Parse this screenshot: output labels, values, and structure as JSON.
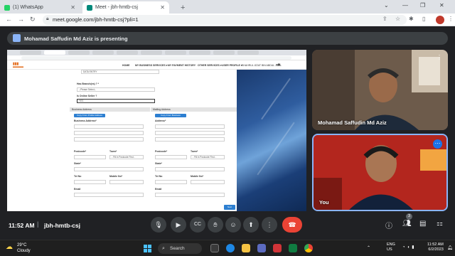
{
  "browser": {
    "tabs": [
      {
        "title": "(1) WhatsApp",
        "color": "#25d366"
      },
      {
        "title": "Meet - jbh-hmtb-csj",
        "color": "#00897b"
      }
    ],
    "new_tab": "+",
    "url": "meet.google.com/jbh-hmtb-csj?pli=1"
  },
  "meet": {
    "presenting_banner": "Mohamad Saffudin Md Aziz is presenting",
    "shared_screen": {
      "site_nav": [
        "HOME",
        "MY BUSINESS SERVICES ▾",
        "MY PAYMENT HISTORY",
        "OTHER SERVICES ▾",
        "USER PROFILE ▾"
      ],
      "user_badge": "SHAHRUL IZZAT BIN ABDUL JALIL",
      "fields": {
        "data_entry": "DATA ENTRY",
        "has_branch_label": "Has Branch(es) ? *",
        "has_branch_value": "--Please Select--",
        "is_online_seller_label": "Is Online Seller ?",
        "is_online_seller_value": "YES",
        "business_address_header": "Business Address",
        "mailing_address_header": "Mailing Address",
        "copy_profile_btn": "Copy From Profile Address",
        "copy_business_btn": "Copy From Business",
        "business_address_label": "Business Address*",
        "address_label": "Address*",
        "postcode_label": "Postcode*",
        "town_label": "Town*",
        "town_placeholder": "- Fill in Postcode First -",
        "state_label": "State*",
        "tel_label": "Tel No",
        "mobile_label": "Mobile No*",
        "email_label": "Email",
        "next_btn": "Next"
      }
    },
    "tiles": [
      {
        "name": "Mohamad Saffudin Md Aziz"
      },
      {
        "name": "You"
      }
    ],
    "bottom": {
      "time": "11:52 AM",
      "separator": "|",
      "meeting_code": "jbh-hmtb-csj",
      "participant_count": "3"
    }
  },
  "taskbar": {
    "weather_temp": "29°C",
    "weather_desc": "Cloudy",
    "search_label": "Search",
    "lang_1": "ENG",
    "lang_2": "US",
    "time": "11:52 AM",
    "date": "6/2/2023"
  }
}
